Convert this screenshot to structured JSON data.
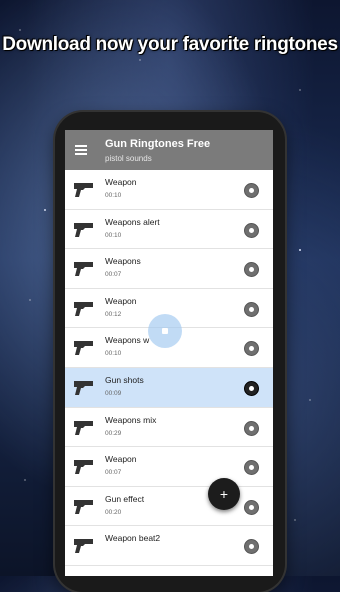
{
  "headline": "Download now your favorite ringtones",
  "app": {
    "title": "Gun Ringtones Free",
    "subtitle": "pistol sounds"
  },
  "icons": {
    "menu": "hamburger-menu-icon",
    "row": "pistol-icon",
    "play": "play-icon",
    "fab": "plus-icon"
  },
  "colors": {
    "appbar": "#7b7b7b",
    "active_row": "#cfe3f9",
    "fab": "#1c1c1c"
  },
  "fab_label": "+",
  "ringtones": [
    {
      "name": "Weapon",
      "duration": "00:10"
    },
    {
      "name": "Weapons alert",
      "duration": "00:10"
    },
    {
      "name": "Weapons",
      "duration": "00:07"
    },
    {
      "name": "Weapon",
      "duration": "00:12"
    },
    {
      "name": "Weapons w",
      "duration": "00:10"
    },
    {
      "name": "Gun shots",
      "duration": "00:09"
    },
    {
      "name": "Weapons mix",
      "duration": "00:29"
    },
    {
      "name": "Weapon",
      "duration": "00:07"
    },
    {
      "name": "Gun effect",
      "duration": "00:20"
    },
    {
      "name": "Weapon beat2",
      "duration": ""
    }
  ]
}
